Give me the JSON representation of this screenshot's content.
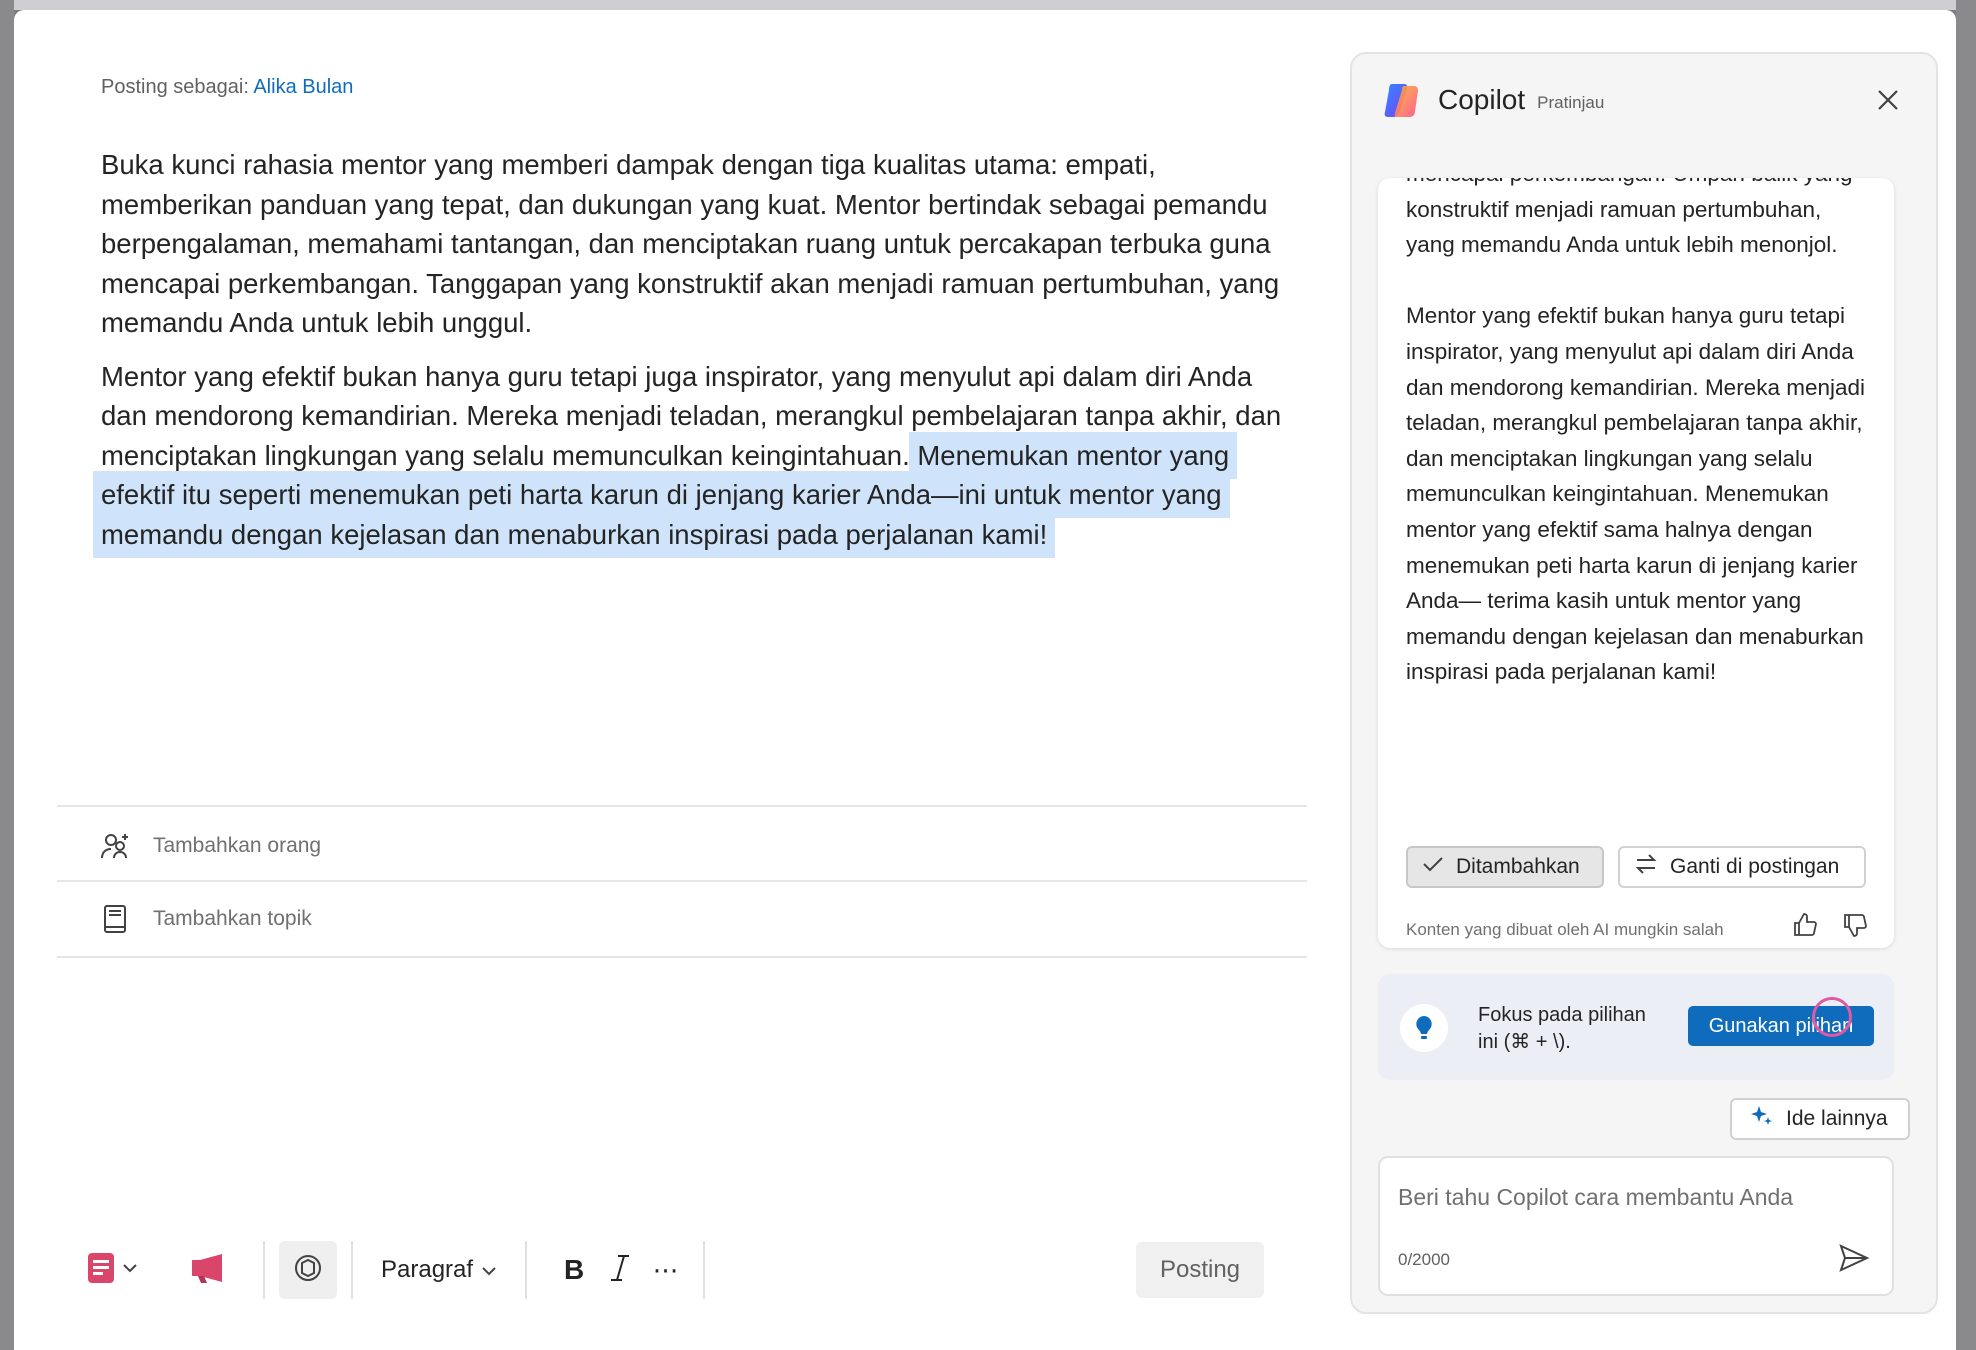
{
  "composer": {
    "posting_as_label": "Posting sebagai:",
    "author": "Alika Bulan",
    "paragraph1": "Buka kunci rahasia mentor yang memberi dampak dengan tiga kualitas utama: empati, memberikan panduan yang tepat, dan dukungan yang kuat. Mentor bertindak sebagai pemandu berpengalaman, memahami tantangan, dan menciptakan ruang untuk percakapan terbuka guna mencapai perkembangan. Tanggapan yang konstruktif akan menjadi ramuan pertumbuhan, yang memandu Anda untuk lebih unggul.",
    "paragraph2_plain": "Mentor yang efektif bukan hanya guru tetapi juga inspirator, yang menyulut api dalam diri Anda dan mendorong kemandirian. Mereka menjadi teladan, merangkul pembelajaran tanpa akhir, dan menciptakan lingkungan yang selalu memunculkan keingintahuan.",
    "paragraph2_selected": "Menemukan mentor yang efektif itu seperti menemukan peti harta karun di jenjang karier Anda—ini untuk mentor yang memandu dengan kejelasan dan menaburkan inspirasi pada perjalanan kami!",
    "add_people": "Tambahkan orang",
    "add_topic": "Tambahkan topik",
    "format_label": "Paragraf",
    "post_button": "Posting"
  },
  "copilot": {
    "title": "Copilot",
    "badge": "Pratinjau",
    "suggestion_p1": "mencapai perkembangan. Umpan balik yang konstruktif menjadi ramuan pertumbuhan, yang memandu Anda untuk lebih menonjol.",
    "suggestion_p2": "Mentor yang efektif bukan hanya guru tetapi inspirator, yang menyulut api dalam diri Anda dan mendorong kemandirian. Mereka menjadi teladan, merangkul pembelajaran tanpa akhir, dan menciptakan lingkungan yang selalu memunculkan keingintahuan. Menemukan mentor yang efektif sama halnya dengan menemukan peti harta karun di jenjang karier Anda— terima kasih untuk mentor yang memandu dengan kejelasan dan menaburkan inspirasi pada perjalanan kami!",
    "added_button": "Ditambahkan",
    "replace_button": "Ganti di postingan",
    "disclaimer": "Konten yang dibuat oleh AI mungkin salah",
    "focus_text": "Fokus pada pilihan ini (⌘ + \\).",
    "use_selection_button": "Gunakan pilihan",
    "more_ideas_button": "Ide lainnya",
    "input_placeholder": "Beri tahu Copilot cara membantu Anda",
    "char_count": "0/2000"
  },
  "colors": {
    "accent": "#0f6cbd",
    "selection": "#cfe4fa",
    "panel_bg": "#f5f5f5"
  }
}
